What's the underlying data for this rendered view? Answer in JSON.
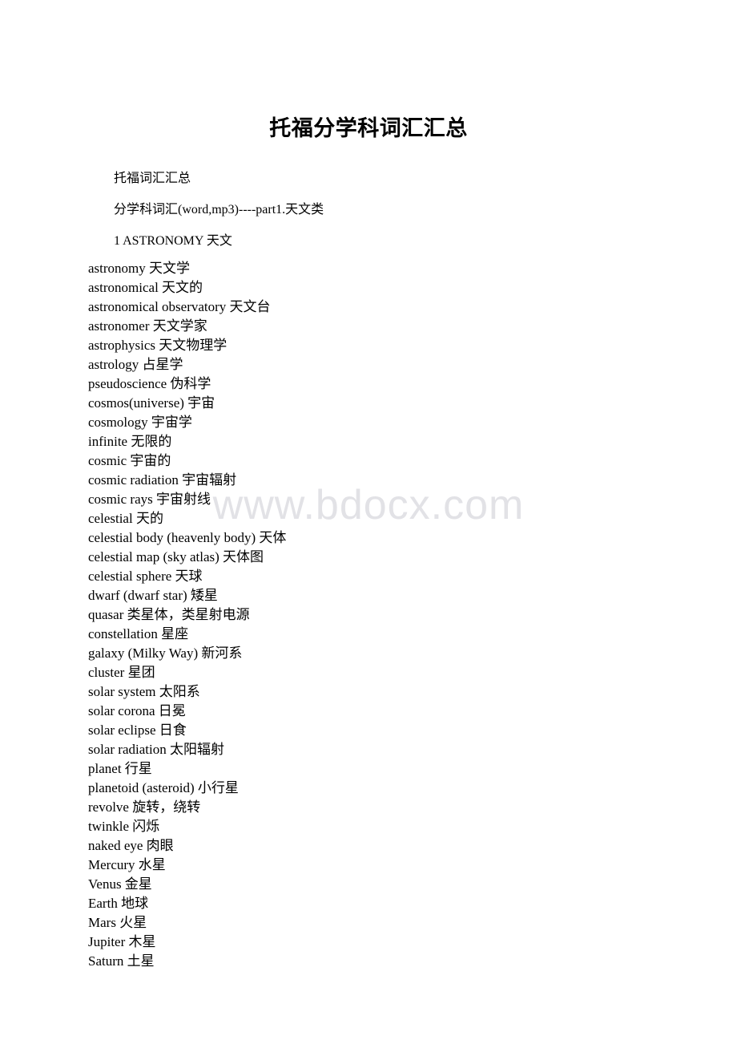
{
  "document": {
    "title": "托福分学科词汇汇总",
    "watermark": "www.bdocx.com",
    "intro": [
      "托福词汇汇总",
      "分学科词汇(word,mp3)----part1.天文类",
      "1 ASTRONOMY 天文"
    ],
    "vocabulary": [
      "astronomy 天文学",
      "astronomical 天文的",
      "astronomical observatory 天文台",
      "astronomer 天文学家",
      "astrophysics 天文物理学",
      "astrology 占星学",
      "pseudoscience 伪科学",
      "cosmos(universe) 宇宙",
      "cosmology 宇宙学",
      "infinite 无限的",
      "cosmic 宇宙的",
      "cosmic radiation 宇宙辐射",
      "cosmic rays 宇宙射线",
      "celestial 天的",
      "celestial body (heavenly body) 天体",
      "celestial map (sky atlas) 天体图",
      "celestial sphere 天球",
      "dwarf (dwarf star) 矮星",
      "quasar 类星体，类星射电源",
      "constellation 星座",
      "galaxy (Milky Way) 新河系",
      "cluster 星团",
      "solar system 太阳系",
      "solar corona 日冕",
      "solar eclipse 日食",
      "solar radiation 太阳辐射",
      "planet 行星",
      "planetoid (asteroid) 小行星",
      "revolve 旋转，绕转",
      "twinkle 闪烁",
      "naked eye 肉眼",
      "Mercury 水星",
      "Venus 金星",
      "Earth 地球",
      "Mars 火星",
      "Jupiter 木星",
      "Saturn 土星"
    ]
  },
  "colors": {
    "page_background": "#ffffff",
    "text": "#000000",
    "watermark": "#e2e2e6"
  }
}
